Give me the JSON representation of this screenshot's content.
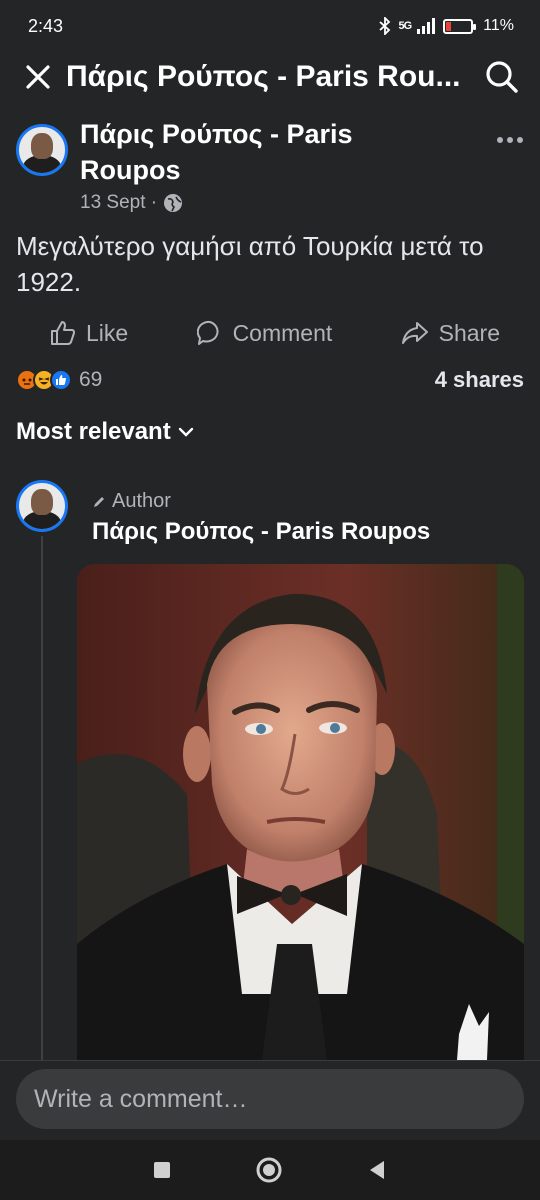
{
  "status_bar": {
    "time": "2:43",
    "network": "5G",
    "battery": "11%"
  },
  "header": {
    "title": "Πάρις Ρούπος - Paris Rou..."
  },
  "post": {
    "author": "Πάρις Ρούπος - Paris Roupos",
    "date": "13 Sept ·",
    "text": "Μεγαλύτερο γαμήσι από Τουρκία μετά το 1922."
  },
  "actions": {
    "like": "Like",
    "comment": "Comment",
    "share": "Share"
  },
  "stats": {
    "reaction_count": "69",
    "shares": "4 shares"
  },
  "sort": {
    "label": "Most relevant"
  },
  "comment": {
    "badge": "Author",
    "author": "Πάρις Ρούπος - Paris Roupos"
  },
  "composer": {
    "placeholder": "Write a comment…"
  },
  "colors": {
    "background": "#242526",
    "accent": "#1877f2",
    "muted_text": "#b0b3b8"
  }
}
